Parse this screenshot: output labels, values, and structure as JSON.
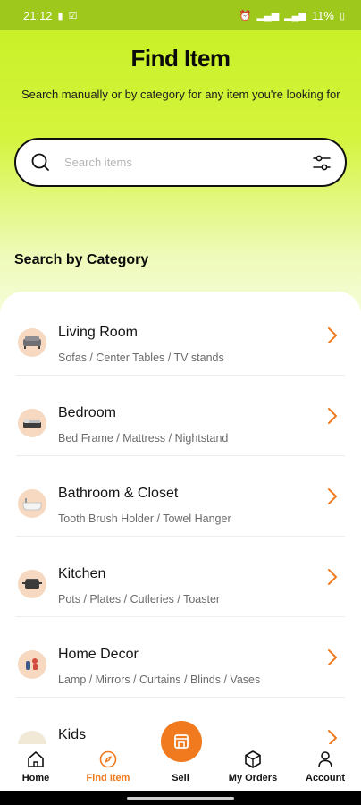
{
  "status_bar": {
    "time": "21:12",
    "battery": "11%"
  },
  "header": {
    "title": "Find Item",
    "subtitle": "Search manually or by category for any item you're looking for"
  },
  "search": {
    "placeholder": "Search items",
    "value": ""
  },
  "section": {
    "title": "Search by Category"
  },
  "categories": [
    {
      "name": "Living Room",
      "subtitle": "Sofas / Center Tables / TV stands",
      "icon": "sofa-icon"
    },
    {
      "name": "Bedroom",
      "subtitle": "Bed Frame / Mattress / Nightstand",
      "icon": "bed-icon"
    },
    {
      "name": "Bathroom & Closet",
      "subtitle": "Tooth Brush Holder / Towel Hanger",
      "icon": "bathtub-icon"
    },
    {
      "name": "Kitchen",
      "subtitle": "Pots / Plates / Cutleries / Toaster",
      "icon": "pot-icon"
    },
    {
      "name": "Home Decor",
      "subtitle": "Lamp / Mirrors / Curtains / Blinds / Vases",
      "icon": "vase-icon"
    },
    {
      "name": "Kids",
      "subtitle": "",
      "icon": "kids-icon"
    }
  ],
  "nav": {
    "home": "Home",
    "find_item": "Find Item",
    "sell": "Sell",
    "my_orders": "My Orders",
    "account": "Account",
    "active": "find_item"
  },
  "colors": {
    "accent": "#f07a1d",
    "lime": "#c6ef22",
    "status_bar": "#9ec81b"
  }
}
